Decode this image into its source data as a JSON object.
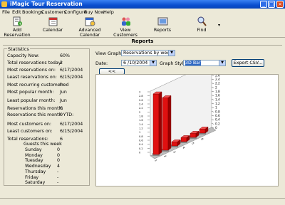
{
  "window": {
    "title": "iMagic Tour Reservation"
  },
  "menu": [
    "File",
    "Edit",
    "Bookings",
    "Customers",
    "Configure",
    "Buy Now",
    "Help"
  ],
  "toolbar": {
    "add_reservation": "Add Reservation",
    "calendar": "Calendar",
    "advanced_calendar": "Advanced Calendar",
    "view_customers": "View Customers",
    "reports": "Reports",
    "find": "Find"
  },
  "page_title": "Reports",
  "statistics": {
    "legend": "Statistics",
    "rows": [
      {
        "label": "Capacity Now:",
        "value": "60%"
      },
      {
        "label": "Total reservations today:",
        "value": "2"
      },
      {
        "label": "Most reservations on:",
        "value": "6/17/2004"
      },
      {
        "label": "Least reservations on:",
        "value": "6/15/2004"
      },
      {
        "label": "Most recurring customer:",
        "value": "fred"
      },
      {
        "label": "Most popular month:",
        "value": "Jun"
      },
      {
        "label": "Least popular month:",
        "value": "Jun"
      },
      {
        "label": "Reservations this month:",
        "value": "6"
      },
      {
        "label": "Reservations this month YTD:",
        "value": "0"
      },
      {
        "label": "Most customers on:",
        "value": "6/17/2004"
      },
      {
        "label": "Least customers on:",
        "value": "6/15/2004"
      },
      {
        "label": "Total reservations:",
        "value": "6"
      }
    ],
    "week_header": "Guests this week",
    "week": [
      {
        "day": "Sunday",
        "value": "0"
      },
      {
        "day": "Monday",
        "value": "0"
      },
      {
        "day": "Tuesday",
        "value": "0"
      },
      {
        "day": "Wednesday",
        "value": "4"
      },
      {
        "day": "Thursday",
        "value": "-"
      },
      {
        "day": "Friday",
        "value": "-"
      },
      {
        "day": "Saturday",
        "value": "-"
      }
    ]
  },
  "controls": {
    "view_graph_label": "View Graph:",
    "view_graph_value": "Reservations by week",
    "date_label": "Date:",
    "date_value": "6 /10/2004",
    "graph_style_label": "Graph Style:",
    "graph_style_value": "3D Bar",
    "export_button": "Export CSV...",
    "expand_button": "<< Expand"
  },
  "colors": {
    "bar": "#e01010",
    "titlebar": "#0a4fd0"
  },
  "chart_data": {
    "type": "bar",
    "style": "3d",
    "categories": [
      "1",
      "2",
      "3",
      "4",
      "5",
      "6"
    ],
    "values": [
      3.0,
      2.6,
      0.2,
      0.2,
      0.2,
      0.2
    ],
    "ylim": [
      0,
      3.0
    ],
    "yticks": [
      "0",
      "0.2",
      "0.4",
      "0.6",
      "0.8",
      "1",
      "1.2",
      "1.4",
      "1.6",
      "1.8",
      "2",
      "2.2",
      "2.4",
      "2.6",
      "2.8",
      "3"
    ]
  }
}
